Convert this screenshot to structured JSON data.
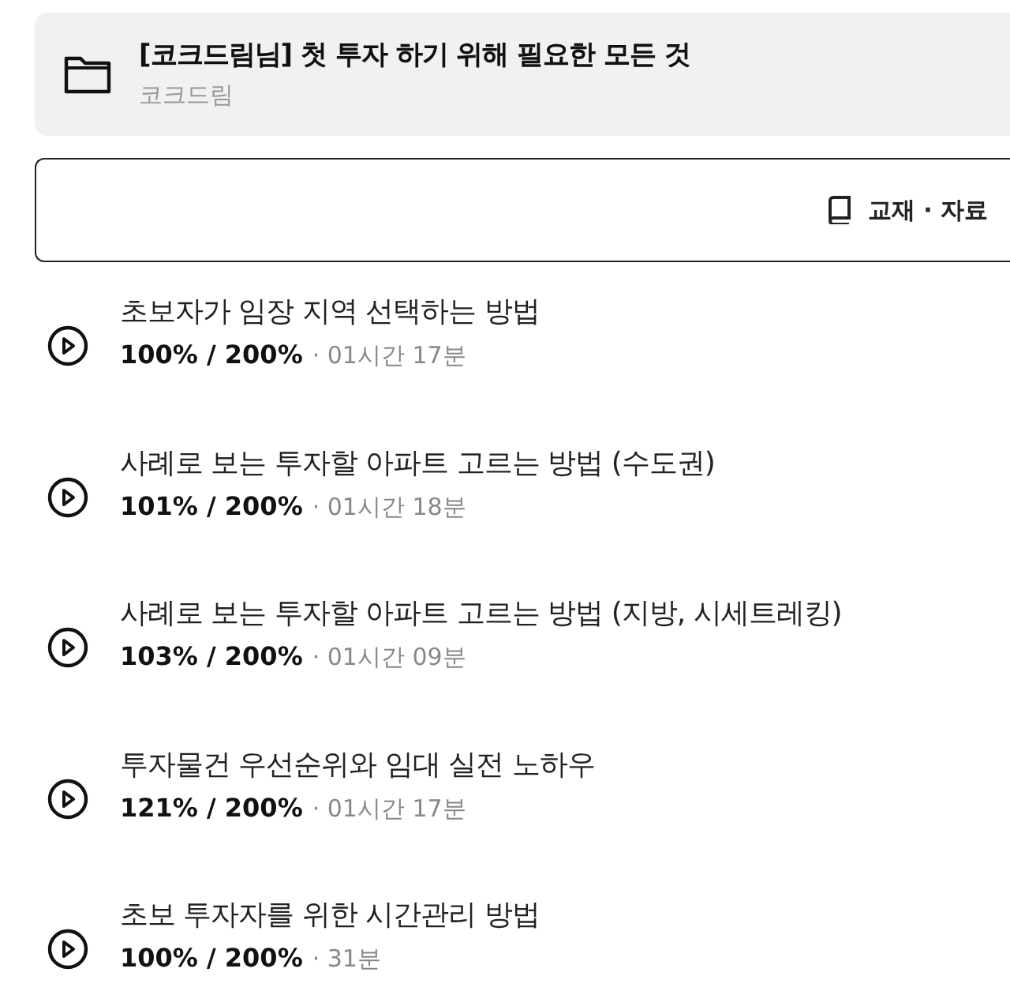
{
  "course": {
    "title": "[코크드림님] 첫 투자 하기 위해 필요한 모든 것",
    "author": "코크드림"
  },
  "materials_button": {
    "label": "교재 · 자료"
  },
  "lessons": [
    {
      "title": "초보자가 임장 지역 선택하는 방법",
      "progress": "100% / 200%",
      "duration": "· 01시간 17분"
    },
    {
      "title": "사례로 보는 투자할 아파트 고르는 방법 (수도권)",
      "progress": "101% / 200%",
      "duration": "· 01시간 18분"
    },
    {
      "title": "사례로 보는 투자할 아파트 고르는 방법 (지방, 시세트레킹)",
      "progress": "103% / 200%",
      "duration": "· 01시간 09분"
    },
    {
      "title": "투자물건 우선순위와 임대 실전 노하우",
      "progress": "121% / 200%",
      "duration": "· 01시간 17분"
    },
    {
      "title": "초보 투자자를 위한 시간관리 방법",
      "progress": "100% / 200%",
      "duration": "· 31분"
    }
  ]
}
